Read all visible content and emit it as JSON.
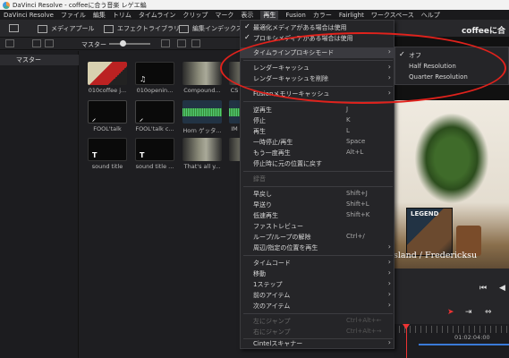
{
  "window": {
    "title": "DaVinci Resolve - coffeeに合う音楽 レゲエ編"
  },
  "menubar": [
    "DaVinci Resolve",
    "ファイル",
    "編集",
    "トリム",
    "タイムライン",
    "クリップ",
    "マーク",
    "表示",
    "再生",
    "Fusion",
    "カラー",
    "Fairlight",
    "ワークスペース",
    "ヘルプ"
  ],
  "toolbar": {
    "media_pool": "メディアプール",
    "effects_library": "エフェクトライブラリ",
    "edit_index": "編集インデックス",
    "project_name": "coffeeに合"
  },
  "subbar": {
    "bin_label": "マスター"
  },
  "sidebar": {
    "root_bin": "マスター"
  },
  "media_pool": {
    "clips": [
      {
        "name": "010coffee j...",
        "thumb": "red"
      },
      {
        "name": "010openin...",
        "thumb": "note"
      },
      {
        "name": "Compound...",
        "thumb": "comp"
      },
      {
        "name": "CS",
        "thumb": "comp"
      },
      {
        "name": "FOOL'talk",
        "thumb": "fool"
      },
      {
        "name": "FOOL'talk c...",
        "thumb": "fool"
      },
      {
        "name": "Horn ゲッタ...",
        "thumb": "wave"
      },
      {
        "name": "IM",
        "thumb": "wave"
      },
      {
        "name": "sound title",
        "thumb": "title"
      },
      {
        "name": "sound title ...",
        "thumb": "title"
      },
      {
        "name": "That's all y...",
        "thumb": "comp"
      },
      {
        "name": "",
        "thumb": "comp"
      }
    ],
    "glyph_note": "♫",
    "glyph_fool": "⸝",
    "glyph_title": "T"
  },
  "playback_menu": {
    "items": [
      {
        "label": "最適化メディアがある場合は使用",
        "checked": true,
        "shortcut": "",
        "submenu": false,
        "disabled": false
      },
      {
        "label": "プロキシメディアがある場合は使用",
        "checked": true,
        "shortcut": "",
        "submenu": false,
        "disabled": false
      },
      {
        "label": "タイムラインプロキシモード",
        "checked": false,
        "shortcut": "",
        "submenu": true,
        "disabled": false,
        "highlighted": true
      },
      {
        "label": "レンダーキャッシュ",
        "submenu": true
      },
      {
        "label": "レンダーキャッシュを削除",
        "submenu": true
      },
      {
        "label": "Fusionメモリーキャッシュ",
        "submenu": true
      },
      {
        "label": "逆再生",
        "shortcut": "J"
      },
      {
        "label": "停止",
        "shortcut": "K"
      },
      {
        "label": "再生",
        "shortcut": "L"
      },
      {
        "label": "一時停止/再生",
        "shortcut": "Space"
      },
      {
        "label": "もう一度再生",
        "shortcut": "Alt+L"
      },
      {
        "label": "停止時に元の位置に戻す",
        "shortcut": ""
      },
      {
        "label": "録音",
        "disabled": true
      },
      {
        "label": "早戻し",
        "shortcut": "Shift+J"
      },
      {
        "label": "早送り",
        "shortcut": "Shift+L"
      },
      {
        "label": "低速再生",
        "shortcut": "Shift+K"
      },
      {
        "label": "ファストレビュー",
        "shortcut": ""
      },
      {
        "label": "ループ/ループの解除",
        "shortcut": "Ctrl+/"
      },
      {
        "label": "周辺/指定の位置を再生",
        "submenu": true
      },
      {
        "label": "タイムコード",
        "submenu": true
      },
      {
        "label": "移動",
        "submenu": true
      },
      {
        "label": "1ステップ",
        "submenu": true
      },
      {
        "label": "前のアイテム",
        "submenu": true
      },
      {
        "label": "次のアイテム",
        "submenu": true
      },
      {
        "label": "左にジャンプ",
        "shortcut": "Ctrl+Alt+←",
        "disabled": true
      },
      {
        "label": "右にジャンプ",
        "shortcut": "Ctrl+Alt+→",
        "disabled": true
      },
      {
        "label": "Cintelスキャナー",
        "submenu": true
      }
    ]
  },
  "proxy_submenu": {
    "items": [
      {
        "label": "オフ",
        "checked": true
      },
      {
        "label": "Half Resolution",
        "checked": false
      },
      {
        "label": "Quarter Resolution",
        "checked": false
      }
    ]
  },
  "viewer": {
    "album_text": "LEGEND",
    "subtitle": "sland / Fredericksu"
  },
  "timeline": {
    "timecode": "01:02:04:00"
  },
  "glyphs": {
    "check": "✓",
    "arrow": "›"
  },
  "colors": {
    "annotation": "#e0221c",
    "playhead": "#e33",
    "accent_blue": "#3a7ad8"
  }
}
